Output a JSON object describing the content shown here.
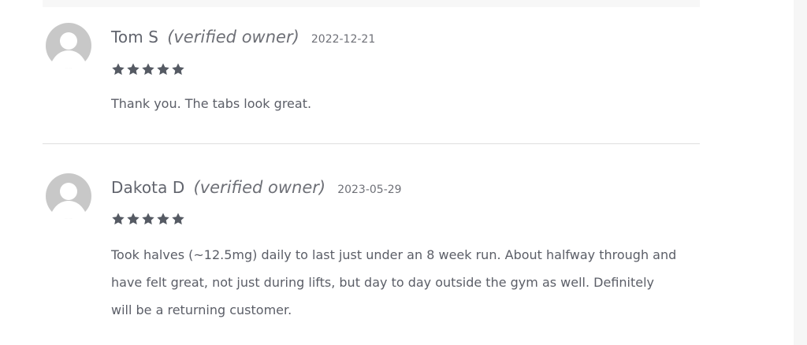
{
  "colors": {
    "text": "#5b5e67",
    "star": "#555a63",
    "avatar_bg": "#c8c8c8",
    "avatar_fg": "#ffffff",
    "divider": "#dedede",
    "right_strip": "#f6f6f6"
  },
  "reviews": [
    {
      "author": "Tom S",
      "verified_label": "(verified owner)",
      "date": "2022-12-21",
      "rating": 5,
      "text": "Thank you. The tabs look great."
    },
    {
      "author": "Dakota D",
      "verified_label": "(verified owner)",
      "date": "2023-05-29",
      "rating": 5,
      "text": "Took halves (~12.5mg) daily to last just under an 8 week run. About halfway through and have felt great, not just during lifts, but day to day outside the gym as well. Definitely will be a returning customer."
    }
  ]
}
